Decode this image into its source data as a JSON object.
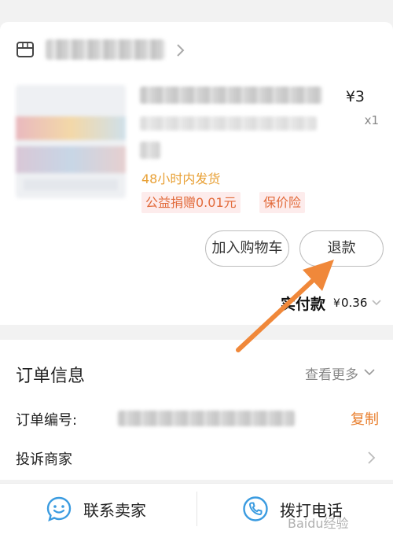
{
  "shop": {
    "name_obscured": true
  },
  "product": {
    "price": "¥3",
    "quantity": "x1",
    "shipping_tag": "48小时内发货",
    "tags": [
      "公益捐赠0.01元",
      "保价险"
    ]
  },
  "actions": {
    "add_to_cart": "加入购物车",
    "refund": "退款"
  },
  "payment": {
    "label": "实付款",
    "currency": "¥",
    "amount": "0.36"
  },
  "order_info": {
    "title": "订单信息",
    "view_more": "查看更多",
    "order_no_label": "订单编号:",
    "copy": "复制",
    "complain": "投诉商家"
  },
  "bottom_bar": {
    "contact_seller": "联系卖家",
    "call": "拨打电话"
  },
  "watermark": "Baidu经验",
  "colors": {
    "accent_orange": "#e87d2b",
    "tag_text": "#e26a3a",
    "tag_bg": "#fdecec",
    "ship_tag": "#e8a035",
    "icon_blue": "#3a9be0",
    "annotation_arrow": "#f0883a"
  }
}
